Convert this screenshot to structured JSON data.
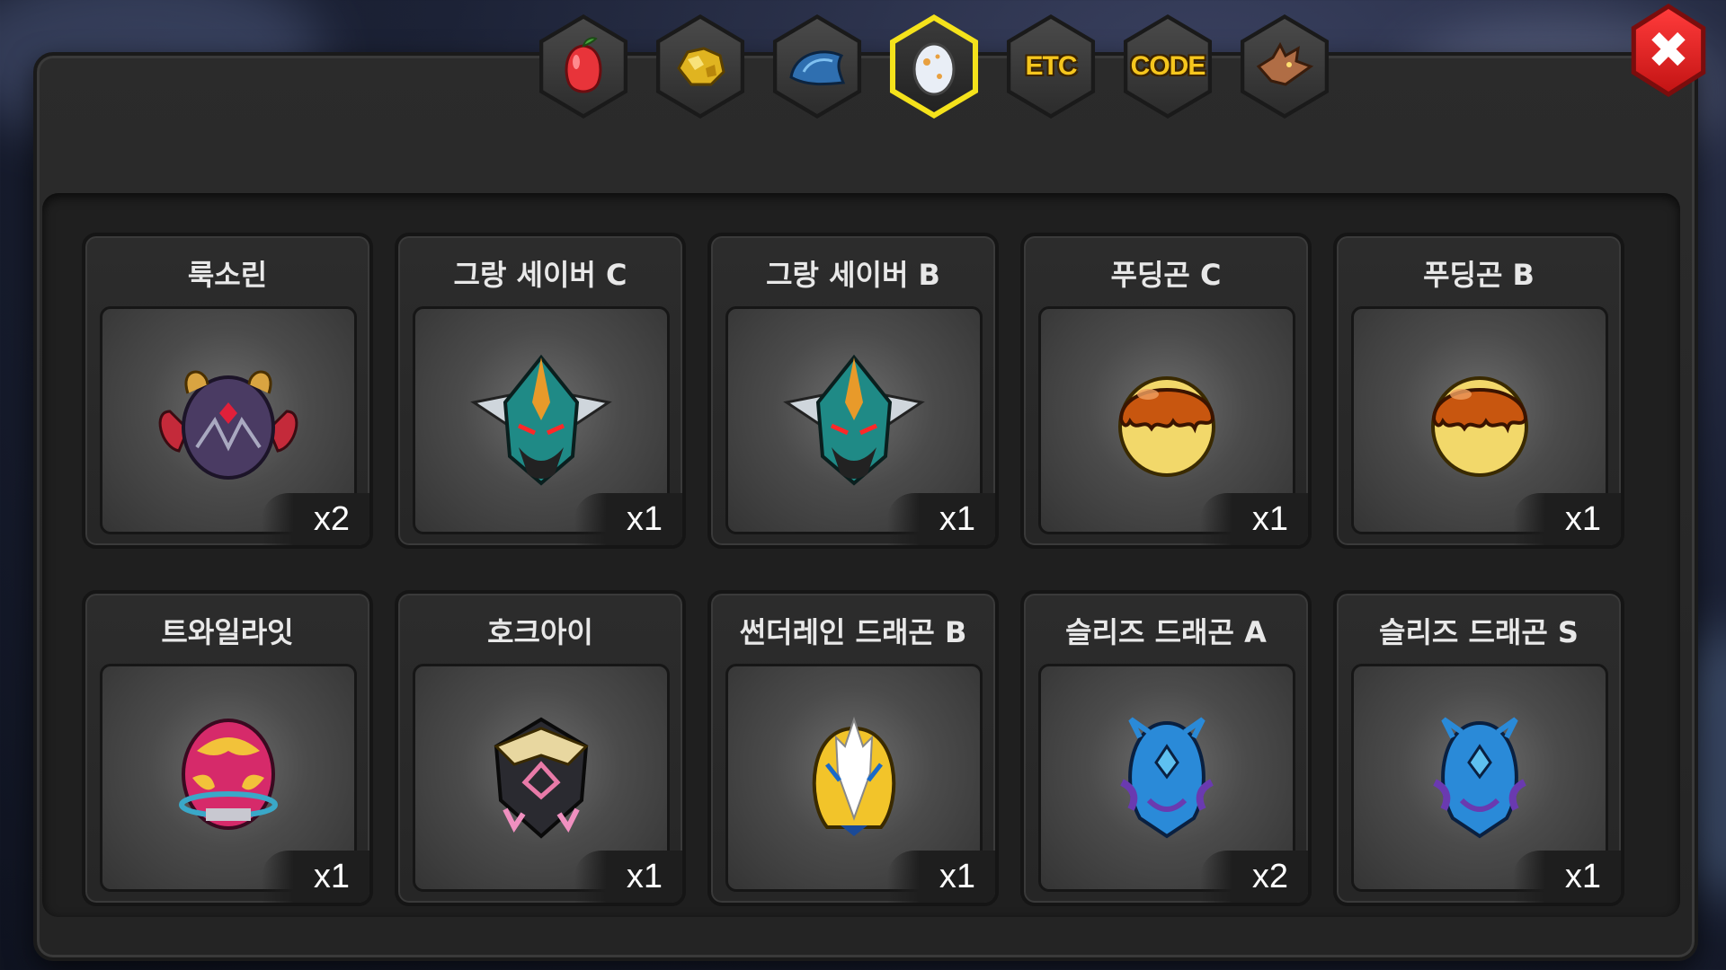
{
  "tabs": [
    {
      "name": "fruit",
      "icon": "red-fruit-icon",
      "label": ""
    },
    {
      "name": "gold",
      "icon": "gold-nugget-icon",
      "label": ""
    },
    {
      "name": "dragon-scale",
      "icon": "blue-scale-icon",
      "label": ""
    },
    {
      "name": "egg",
      "icon": "egg-icon",
      "label": "",
      "active": true
    },
    {
      "name": "etc",
      "icon": "",
      "label": "ETC"
    },
    {
      "name": "code",
      "icon": "",
      "label": "CODE"
    },
    {
      "name": "dragon",
      "icon": "dragon-head-icon",
      "label": ""
    }
  ],
  "close_label": "✖",
  "items": [
    {
      "name": "룩소린",
      "count": "x2",
      "egg": "luxorin"
    },
    {
      "name": "그랑 세이버 C",
      "count": "x1",
      "egg": "grand-saber"
    },
    {
      "name": "그랑 세이버 B",
      "count": "x1",
      "egg": "grand-saber"
    },
    {
      "name": "푸딩곤 C",
      "count": "x1",
      "egg": "pudding"
    },
    {
      "name": "푸딩곤 B",
      "count": "x1",
      "egg": "pudding"
    },
    {
      "name": "트와일라잇",
      "count": "x1",
      "egg": "twilight"
    },
    {
      "name": "호크아이",
      "count": "x1",
      "egg": "hawkeye"
    },
    {
      "name": "썬더레인 드래곤 B",
      "count": "x1",
      "egg": "thunderrain"
    },
    {
      "name": "슬리즈 드래곤 A",
      "count": "x2",
      "egg": "sleaze"
    },
    {
      "name": "슬리즈 드래곤 S",
      "count": "x1",
      "egg": "sleaze"
    }
  ],
  "colors": {
    "active_tab_border": "#f4e21b",
    "close_button": "#e02020",
    "tab_label": "#f5c61e"
  }
}
